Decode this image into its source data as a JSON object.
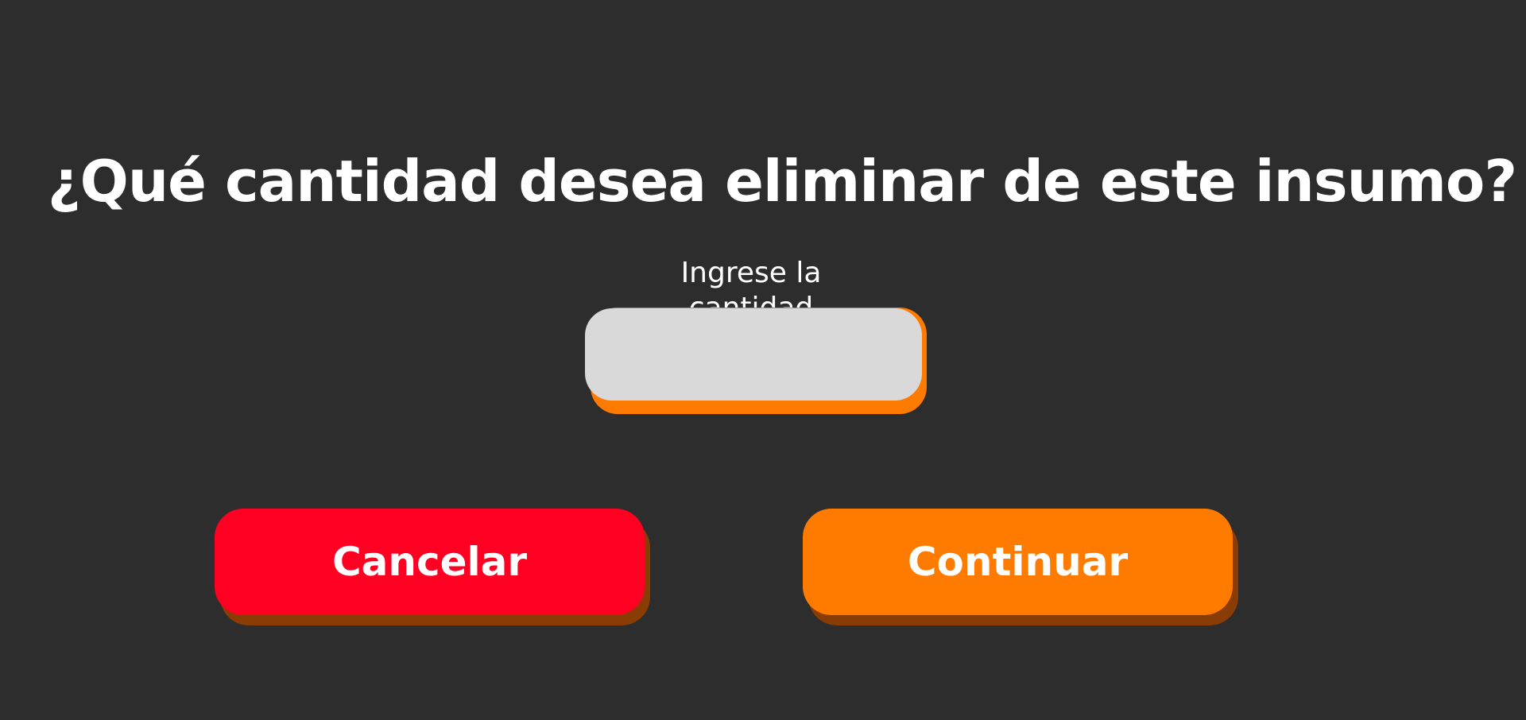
{
  "dialog": {
    "title": "¿Qué cantidad desea eliminar de este insumo?",
    "input_label": "Ingrese la cantidad",
    "input_value": "",
    "input_placeholder": ""
  },
  "actions": {
    "cancel_label": "Cancelar",
    "continue_label": "Continuar"
  },
  "colors": {
    "background": "#2d2d2d",
    "cancel": "#ff0022",
    "continue": "#ff7b00",
    "input_fill": "#d9d9d9",
    "input_accent": "#ff7b00",
    "button_shadow": "#8a3c05"
  }
}
